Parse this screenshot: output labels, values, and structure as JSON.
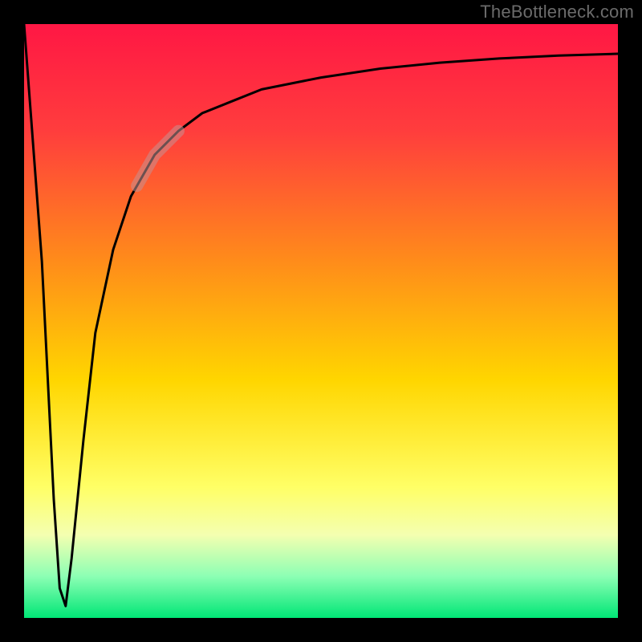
{
  "watermark": "TheBottleneck.com",
  "colors": {
    "frame": "#000000",
    "curve": "#000000",
    "highlight": "#c59292",
    "top": "#ff1744",
    "mid": "#ffd600",
    "bottom": "#00e676"
  },
  "chart_data": {
    "type": "line",
    "title": "",
    "xlabel": "",
    "ylabel": "",
    "xlim": [
      0,
      100
    ],
    "ylim": [
      0,
      100
    ],
    "x": [
      0,
      3,
      5,
      6,
      7,
      8,
      10,
      12,
      15,
      18,
      22,
      26,
      30,
      35,
      40,
      50,
      60,
      70,
      80,
      90,
      100
    ],
    "values": [
      100,
      60,
      20,
      5,
      2,
      10,
      30,
      48,
      62,
      71,
      78,
      82,
      85,
      87,
      89,
      91,
      92.5,
      93.5,
      94.2,
      94.7,
      95
    ],
    "highlight_x_range": [
      19,
      26
    ],
    "gradient_stops": [
      {
        "pct": 0,
        "hex": "#ff1744"
      },
      {
        "pct": 18,
        "hex": "#ff3d3d"
      },
      {
        "pct": 40,
        "hex": "#ff8c1a"
      },
      {
        "pct": 60,
        "hex": "#ffd600"
      },
      {
        "pct": 78,
        "hex": "#ffff66"
      },
      {
        "pct": 86,
        "hex": "#f4ffb0"
      },
      {
        "pct": 93,
        "hex": "#8cffb4"
      },
      {
        "pct": 100,
        "hex": "#00e676"
      }
    ]
  }
}
